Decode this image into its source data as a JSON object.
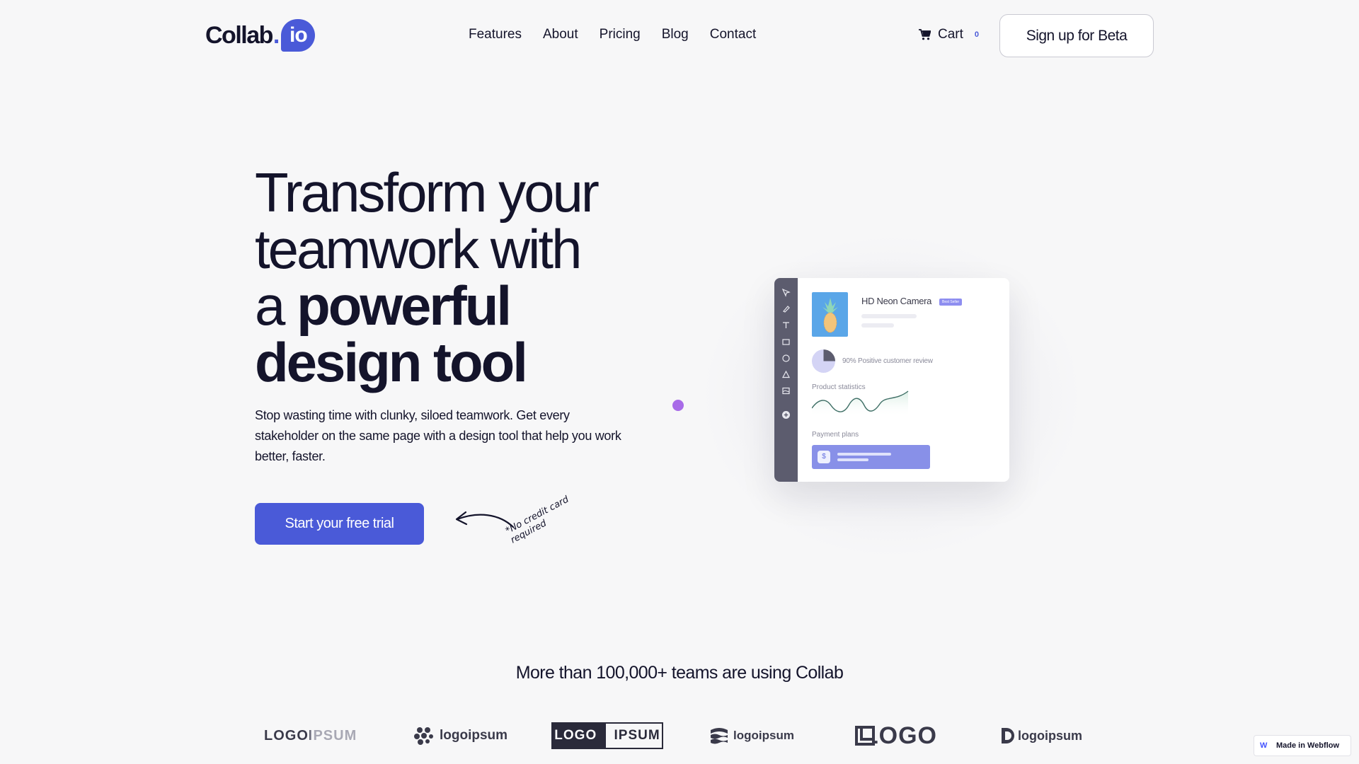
{
  "nav": {
    "logo_word": "Collab",
    "logo_dot": ".",
    "logo_badge": "io",
    "menu": [
      "Features",
      "About",
      "Pricing",
      "Blog",
      "Contact"
    ],
    "cart_label": "Cart",
    "cart_count": "0",
    "signup_label": "Sign up for Beta"
  },
  "hero": {
    "title_line1": "Transform your",
    "title_line2": "teamwork with",
    "title_line3_prefix": "a ",
    "title_line3_bold": "powerful",
    "title_line4_bold": "design tool",
    "description": "Stop wasting time with clunky, siloed teamwork. Get every stakeholder on the same page with a design tool that help you work better, faster.",
    "cta_label": "Start your free trial",
    "note": "*No credit card required"
  },
  "mockup": {
    "product_name": "HD Neon Camera",
    "badge": "Best Seller",
    "review": "90% Positive customer review",
    "review_fraction": 0.25,
    "stats_label": "Product statistics",
    "payment_label": "Payment plans",
    "payment_icon": "$",
    "accent_color": "#8890e8"
  },
  "logos": {
    "heading": "More than 100,000+ teams are using Collab",
    "items": [
      "LOGOIPSUM",
      "logoipsum",
      "LOGO IPSUM",
      "logoipsum",
      "LOGO",
      "logoipsum"
    ]
  },
  "badge": {
    "webflow": "Made in Webflow"
  },
  "colors": {
    "brand": "#4a5ad8",
    "dot": "#a86be8",
    "text": "#14142b"
  }
}
